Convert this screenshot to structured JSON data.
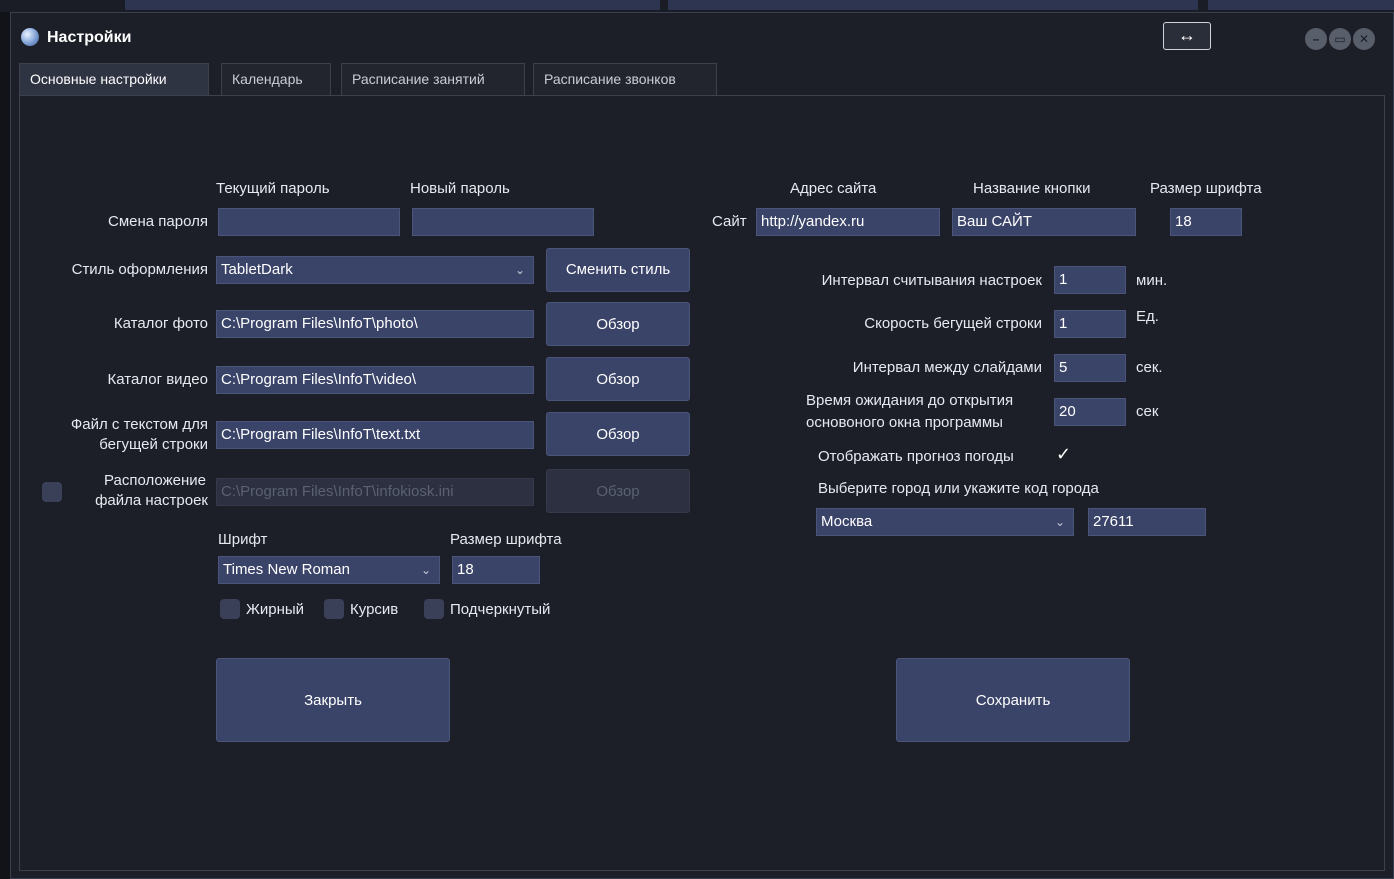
{
  "window": {
    "title": "Настройки",
    "resize_glyph": "↔",
    "controls": [
      "–",
      "▭",
      "✕"
    ]
  },
  "tabs": [
    {
      "label": "Основные настройки",
      "active": true
    },
    {
      "label": "Календарь",
      "active": false
    },
    {
      "label": "Расписание занятий",
      "active": false
    },
    {
      "label": "Расписание звонков",
      "active": false
    }
  ],
  "left": {
    "password_headers": {
      "current": "Текущий пароль",
      "new": "Новый пароль"
    },
    "password_label": "Смена пароля",
    "current_password": "",
    "new_password": "",
    "style_label": "Стиль оформления",
    "style_value": "TabletDark",
    "change_style_button": "Сменить стиль",
    "photo_label": "Каталог фото",
    "photo_path": "C:\\Program Files\\InfoT\\photo\\",
    "video_label": "Каталог видео",
    "video_path": "C:\\Program Files\\InfoT\\video\\",
    "text_label_1": "Файл с текстом для",
    "text_label_2": "бегущей строки",
    "text_path": "C:\\Program Files\\InfoT\\text.txt",
    "settings_label_1": "Расположение",
    "settings_label_2": "файла настроек",
    "settings_path": "C:\\Program Files\\InfoT\\infokiosk.ini",
    "browse_button": "Обзор",
    "font_label": "Шрифт",
    "font_value": "Times New Roman",
    "font_size_label": "Размер шрифта",
    "font_size_value": "18",
    "bold_label": "Жирный",
    "italic_label": "Курсив",
    "underline_label": "Подчеркнутый",
    "close_button": "Закрыть"
  },
  "right": {
    "site_headers": {
      "address": "Адрес сайта",
      "button_name": "Название кнопки",
      "font_size": "Размер шрифта"
    },
    "site_label": "Сайт",
    "site_url": "http://yandex.ru",
    "site_button_name": "Ваш САЙТ",
    "site_font_size": "18",
    "settings_interval_label": "Интервал считывания настроек",
    "settings_interval_value": "1",
    "settings_interval_unit": "мин.",
    "ticker_speed_label": "Скорость бегущей строки",
    "ticker_speed_value": "1",
    "ticker_speed_unit": "Ед.",
    "slide_interval_label": "Интервал между слайдами",
    "slide_interval_value": "5",
    "slide_interval_unit": "сек.",
    "wait_label_1": "Время ожидания до открытия",
    "wait_label_2": "основоного окна программы",
    "wait_value": "20",
    "wait_unit": "сек",
    "weather_label": "Отображать прогноз погоды",
    "weather_checked": true,
    "city_prompt": "Выберите город или укажите код города",
    "city_value": "Москва",
    "city_code": "27611",
    "save_button": "Сохранить"
  },
  "colors": {
    "field": "#3a4368",
    "panel": "#1c1f27",
    "text": "#e6e9f0"
  }
}
